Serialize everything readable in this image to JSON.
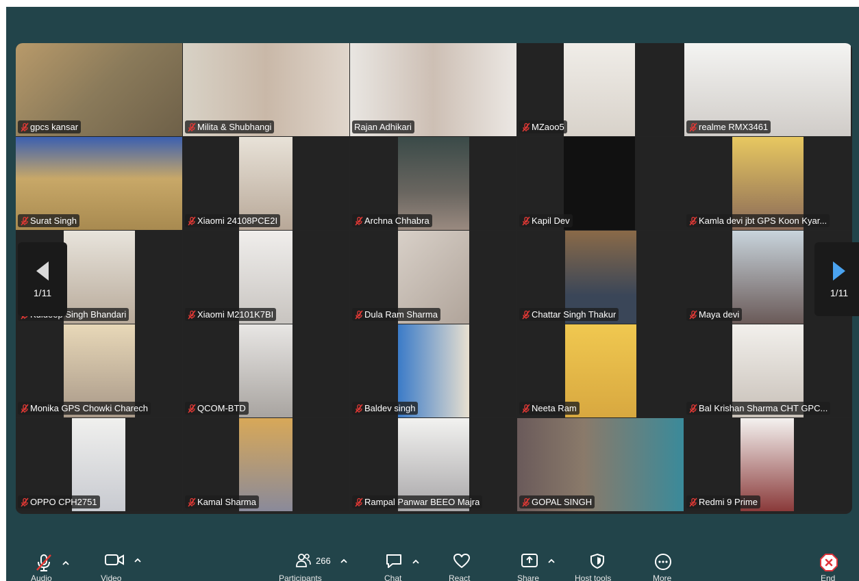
{
  "colors": {
    "background": "#22444a",
    "grid": "#242424",
    "active_border": "#6cc04a",
    "mute": "#e53935",
    "accent": "#4aa3f0",
    "end": "#e0333a"
  },
  "meeting": {
    "page_left": "1/11",
    "page_right": "1/11",
    "participants": [
      {
        "name": "gpcs kansar",
        "muted": true
      },
      {
        "name": "Milita & Shubhangi",
        "muted": true
      },
      {
        "name": "Rajan Adhikari",
        "muted": false,
        "speaking": true
      },
      {
        "name": "MZaoo5",
        "muted": true
      },
      {
        "name": "realme RMX3461",
        "muted": true
      },
      {
        "name": "Surat Singh",
        "muted": true
      },
      {
        "name": "Xiaomi 24108PCE2I",
        "muted": true
      },
      {
        "name": "Archna Chhabra",
        "muted": true
      },
      {
        "name": "Kapil Dev",
        "muted": true
      },
      {
        "name": "Kamla devi jbt GPS Koon Kyar...",
        "muted": true
      },
      {
        "name": "Kuldeep Singh Bhandari",
        "muted": true
      },
      {
        "name": "Xiaomi M2101K7BI",
        "muted": true
      },
      {
        "name": "Dula Ram Sharma",
        "muted": true
      },
      {
        "name": "Chattar Singh Thakur",
        "muted": true
      },
      {
        "name": "Maya devi",
        "muted": true
      },
      {
        "name": "Monika GPS Chowki Charech",
        "muted": true
      },
      {
        "name": "QCOM-BTD",
        "muted": true
      },
      {
        "name": "Baldev singh",
        "muted": true
      },
      {
        "name": "Neeta Ram",
        "muted": true
      },
      {
        "name": "Bal Krishan Sharma CHT GPC...",
        "muted": true
      },
      {
        "name": "OPPO CPH2751",
        "muted": true
      },
      {
        "name": "Kamal Sharma",
        "muted": true
      },
      {
        "name": "Rampal Panwar BEEO  Majra",
        "muted": true
      },
      {
        "name": "GOPAL SINGH",
        "muted": true
      },
      {
        "name": "Redmi 9 Prime",
        "muted": true
      }
    ]
  },
  "toolbar": {
    "audio_label": "Audio",
    "video_label": "Video",
    "participants_label": "Participants",
    "participants_count": "266",
    "chat_label": "Chat",
    "react_label": "React",
    "share_label": "Share",
    "host_tools_label": "Host tools",
    "more_label": "More",
    "end_label": "End",
    "icons": [
      "mic-muted-icon",
      "camera-icon",
      "participants-icon",
      "chat-icon",
      "heart-icon",
      "share-screen-icon",
      "shield-icon",
      "more-icon",
      "end-call-icon"
    ]
  }
}
